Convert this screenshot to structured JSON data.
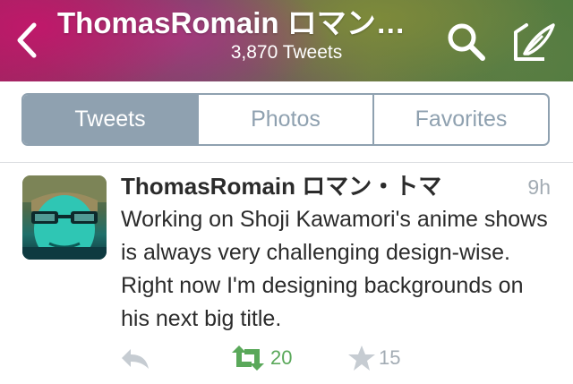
{
  "header": {
    "title": "ThomasRomain ロマン…",
    "subtitle": "3,870 Tweets",
    "icons": {
      "back": "chevron-left-icon",
      "search": "search-icon",
      "compose": "compose-icon"
    }
  },
  "tabs": [
    {
      "label": "Tweets",
      "active": true
    },
    {
      "label": "Photos",
      "active": false
    },
    {
      "label": "Favorites",
      "active": false
    }
  ],
  "tweet": {
    "author": "ThomasRomain ロマン・トマ",
    "time": "9h",
    "text": "Working on Shoji Kawamori's anime shows is always very challenging design-wise. Right now I'm designing backgrounds on his next big title.",
    "retweets": "20",
    "favorites": "15"
  },
  "colors": {
    "tab_accent": "#8fa1b0",
    "retweet_green": "#5aa85a",
    "muted": "#a3acb4"
  }
}
